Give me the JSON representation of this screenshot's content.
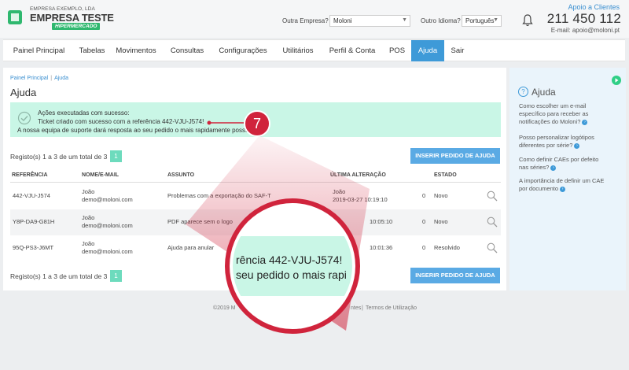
{
  "header": {
    "logo_sub": "EMPRESA EXEMPLO, LDA",
    "logo_title": "EMPRESA TESTE",
    "logo_tag": "HIPERMERCADO",
    "company_label": "Outra Empresa?",
    "company_value": "Moloni",
    "language_label": "Outro Idioma?",
    "language_value": "Português",
    "support_link": "Apoio a Clientes",
    "phone": "211 450 112",
    "email": "E-mail: apoio@moloni.pt"
  },
  "nav": {
    "items": [
      "Painel Principal",
      "Tabelas",
      "Movimentos",
      "Consultas",
      "Configurações",
      "Utilitários",
      "Perfil & Conta",
      "POS",
      "Ajuda",
      "Sair"
    ],
    "active": "Ajuda"
  },
  "main": {
    "breadcrumb": [
      "Painel Principal",
      "Ajuda"
    ],
    "title": "Ajuda",
    "alert": {
      "title": "Ações executadas com sucesso:",
      "line1": "Ticket criado com sucesso com a referência 442-VJU-J574!",
      "line2": "A nossa equipa de suporte dará resposta ao seu pedido o mais rapidamente possível."
    },
    "records_text": "Registo(s) 1 a 3 de um total de 3",
    "page": "1",
    "insert_button": "INSERIR PEDIDO DE AJUDA",
    "columns": [
      "REFERÊNCIA",
      "NOME/E-MAIL",
      "ASSUNTO",
      "ÚLTIMA ALTERAÇÃO",
      "ESTADO"
    ],
    "rows": [
      {
        "ref": "442-VJU-J574",
        "name": "João",
        "email": "demo@moloni.com",
        "subject": "Problemas com a exportação do SAF-T",
        "date": "João",
        "time": "2019-03-27 10:19:10",
        "count": "0",
        "status": "Novo"
      },
      {
        "ref": "Y8P-DA9-G81H",
        "name": "João",
        "email": "demo@moloni.com",
        "subject": "PDF aparece sem o logo",
        "date": "",
        "time": "10:05:10",
        "count": "0",
        "status": "Novo"
      },
      {
        "ref": "95Q-PS3-J6MT",
        "name": "João",
        "email": "demo@moloni.com",
        "subject": "Ajuda para anular",
        "date": "",
        "time": "10:01:36",
        "count": "0",
        "status": "Resolvido"
      }
    ]
  },
  "sidebar": {
    "title": "Ajuda",
    "links": [
      "Como escolher um e-mail específico para receber as notificações do Moloni?",
      "Posso personalizar logótipos diferentes por série?",
      "Como definir CAEs por defeito nas séries?",
      "A importância de definir um CAE por documento"
    ]
  },
  "footer": {
    "copyright": "©2019 M",
    "links_tail": "ntes",
    "terms": "Termos de Utilização"
  },
  "callout": {
    "number": "7",
    "lens_line1": "rência 442-VJU-J574!",
    "lens_line2": "seu pedido o mais rapi"
  },
  "colors": {
    "accent": "#3e9ad8",
    "success_bg": "#c9f6e6",
    "brand_green": "#2fb86f",
    "callout_red": "#d0243c"
  }
}
